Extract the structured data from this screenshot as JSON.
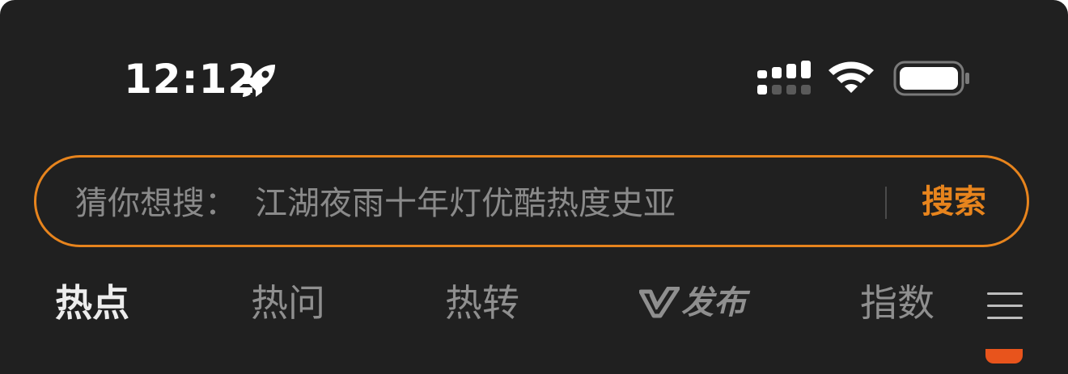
{
  "status_bar": {
    "time": "12:12",
    "icons": [
      "rocket-icon",
      "cellular-signal-icon",
      "wifi-icon",
      "battery-icon"
    ]
  },
  "search": {
    "prefix": "猜你想搜：",
    "suggestion": "江湖夜雨十年灯优酷热度史亚",
    "button_label": "搜索"
  },
  "tabs": [
    {
      "label": "热点",
      "active": true
    },
    {
      "label": "热问",
      "active": false
    },
    {
      "label": "热转",
      "active": false
    },
    {
      "label": "发布",
      "active": false,
      "icon": "v-logo-icon"
    },
    {
      "label": "指数",
      "active": false
    }
  ],
  "menu": {
    "icon": "menu-icon"
  },
  "colors": {
    "background": "#202020",
    "accent": "#e7841d",
    "text_primary": "#ededed",
    "text_secondary": "#8f8f8f"
  }
}
